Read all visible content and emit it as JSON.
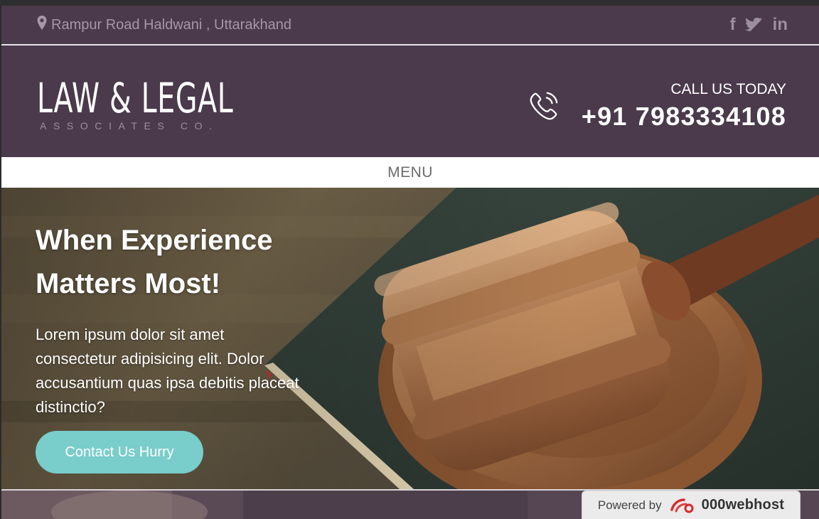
{
  "topbar": {
    "address": "Rampur Road Haldwani , Uttarakhand",
    "social": [
      {
        "icon": "facebook-icon",
        "glyph": "f"
      },
      {
        "icon": "twitter-icon",
        "glyph": ""
      },
      {
        "icon": "linkedin-icon",
        "glyph": "in"
      }
    ]
  },
  "header": {
    "logo_main": "LAW & LEGAL",
    "logo_sub": "ASSOCIATES CO.",
    "call_label": "CALL US TODAY",
    "call_number": "+91 7983334108"
  },
  "menu": {
    "label": "MENU"
  },
  "hero": {
    "title_line1": "When Experience",
    "title_line2": "Matters Most!",
    "text": "Lorem ipsum dolor sit amet consectetur adipisicing elit. Dolor accusantium quas ipsa debitis placeat distinctio?",
    "cta_label": "Contact Us Hurry"
  },
  "footer_badge": {
    "powered_by": "Powered by",
    "brand": "000webhost"
  },
  "colors": {
    "header_bg": "#4a3a4c",
    "accent": "#79cdcb",
    "white": "#ffffff"
  }
}
